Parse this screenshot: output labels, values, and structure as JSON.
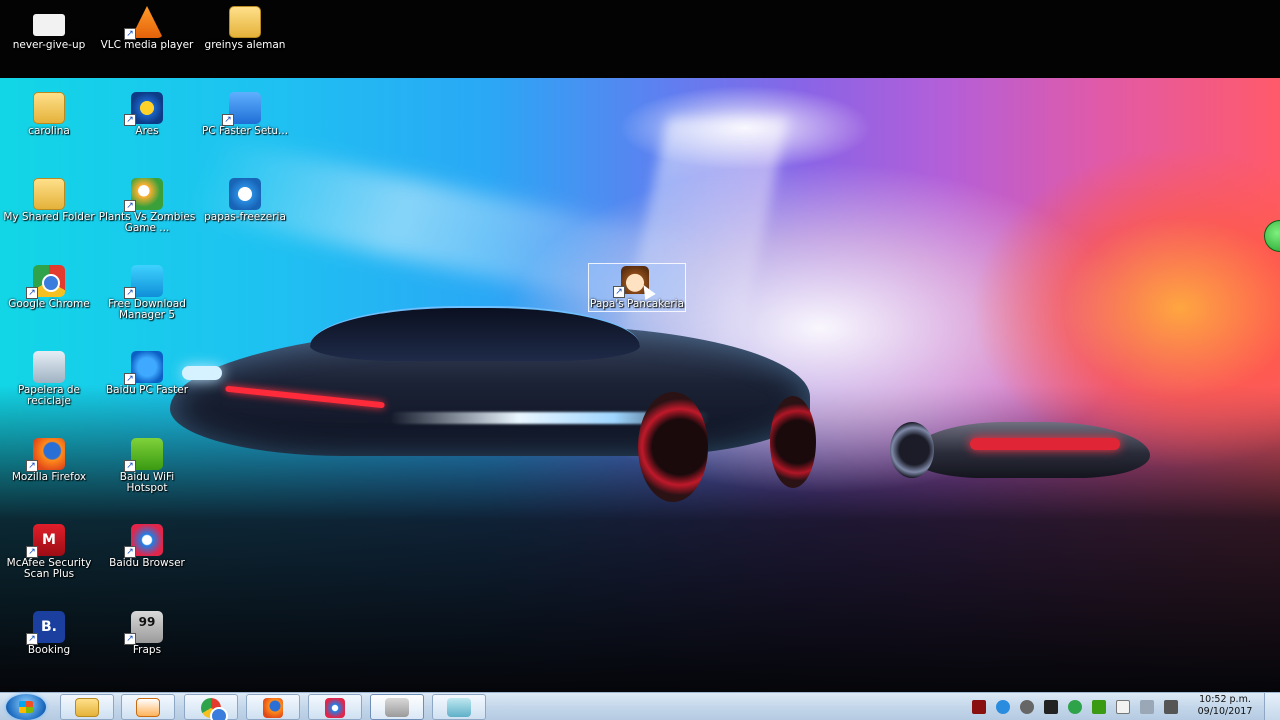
{
  "desktop": {
    "top_icons": [
      {
        "label": "never-give-up",
        "icon": "file-icon"
      },
      {
        "label": "VLC media player",
        "icon": "vlc-icon"
      },
      {
        "label": "greinys  aleman",
        "icon": "folder-icon"
      }
    ],
    "icons": [
      {
        "label": "carolina",
        "icon": "folder-icon"
      },
      {
        "label": "Ares",
        "icon": "ares-icon"
      },
      {
        "label": "PC Faster Setu...",
        "icon": "pc-faster-setup-icon"
      },
      {
        "label": "My Shared Folder",
        "icon": "folder-icon"
      },
      {
        "label": "Plants Vs Zombies Game ...",
        "icon": "plants-vs-zombies-icon"
      },
      {
        "label": "papas-freezeria",
        "icon": "internet-explorer-icon"
      },
      {
        "label": "Google Chrome",
        "icon": "chrome-icon"
      },
      {
        "label": "Free Download Manager 5",
        "icon": "download-manager-icon"
      },
      {
        "label": "Papelera de reciclaje",
        "icon": "recycle-bin-icon"
      },
      {
        "label": "Baidu PC Faster",
        "icon": "baidu-pc-faster-icon"
      },
      {
        "label": "Mozilla Firefox",
        "icon": "firefox-icon"
      },
      {
        "label": "Baidu WiFi Hotspot",
        "icon": "wifi-hotspot-icon"
      },
      {
        "label": "McAfee Security Scan Plus",
        "icon": "mcafee-icon"
      },
      {
        "label": "Baidu Browser",
        "icon": "baidu-browser-icon"
      },
      {
        "label": "Booking",
        "icon": "booking-icon"
      },
      {
        "label": "Fraps",
        "icon": "fraps-icon"
      }
    ],
    "selected_icon": {
      "label": "Papa's Pancakeria",
      "icon": "papas-pancakeria-icon"
    },
    "booking_letter": "B.",
    "fraps_badge": "99",
    "mcafee_letter": "M"
  },
  "taskbar": {
    "start_label": "Start",
    "pinned": [
      {
        "name": "windows-explorer",
        "icon": "folder-icon"
      },
      {
        "name": "media-player",
        "icon": "media-player-icon"
      },
      {
        "name": "chrome",
        "icon": "chrome-icon"
      },
      {
        "name": "firefox",
        "icon": "firefox-icon"
      },
      {
        "name": "baidu-browser",
        "icon": "baidu-browser-icon"
      },
      {
        "name": "fraps",
        "icon": "fraps-icon"
      },
      {
        "name": "unknown-app",
        "icon": "app-icon"
      }
    ],
    "clock": {
      "time": "10:52 p.m.",
      "date": "09/10/2017"
    }
  }
}
